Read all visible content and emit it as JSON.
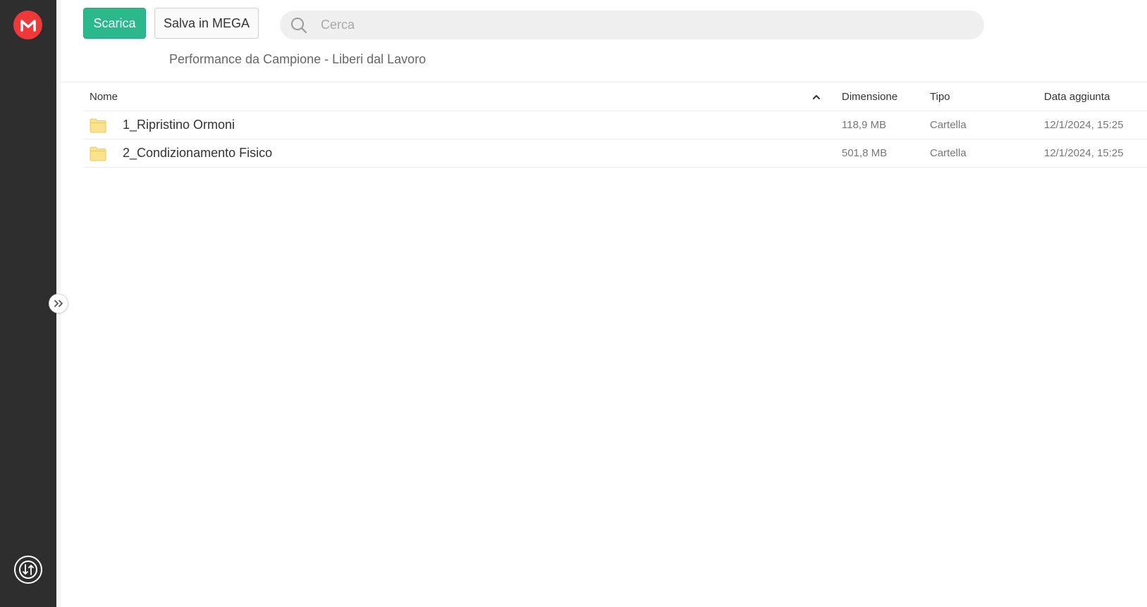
{
  "actions": {
    "download_label": "Scarica",
    "save_label": "Salva in MEGA"
  },
  "search": {
    "placeholder": "Cerca"
  },
  "folder": {
    "title": "Performance da Campione - Liberi dal Lavoro"
  },
  "table": {
    "headers": {
      "name": "Nome",
      "size": "Dimensione",
      "type": "Tipo",
      "date": "Data aggiunta"
    },
    "rows": [
      {
        "name": "1_Ripristino Ormoni",
        "size": "118,9 MB",
        "type": "Cartella",
        "date": "12/1/2024, 15:25"
      },
      {
        "name": "2_Condizionamento Fisico",
        "size": "501,8 MB",
        "type": "Cartella",
        "date": "12/1/2024, 15:25"
      }
    ]
  },
  "colors": {
    "brand": "#f0373a",
    "sidebar": "#2e2e2e",
    "download_button": "#2bb88a",
    "folder_icon": "#fbe38e"
  },
  "icons": {
    "logo": "mega-logo-icon",
    "transfer": "transfer-manager-icon",
    "expand": "expand-sidebar-icon",
    "search": "search-icon",
    "sort": "chevron-up-icon",
    "folder": "folder-icon"
  }
}
